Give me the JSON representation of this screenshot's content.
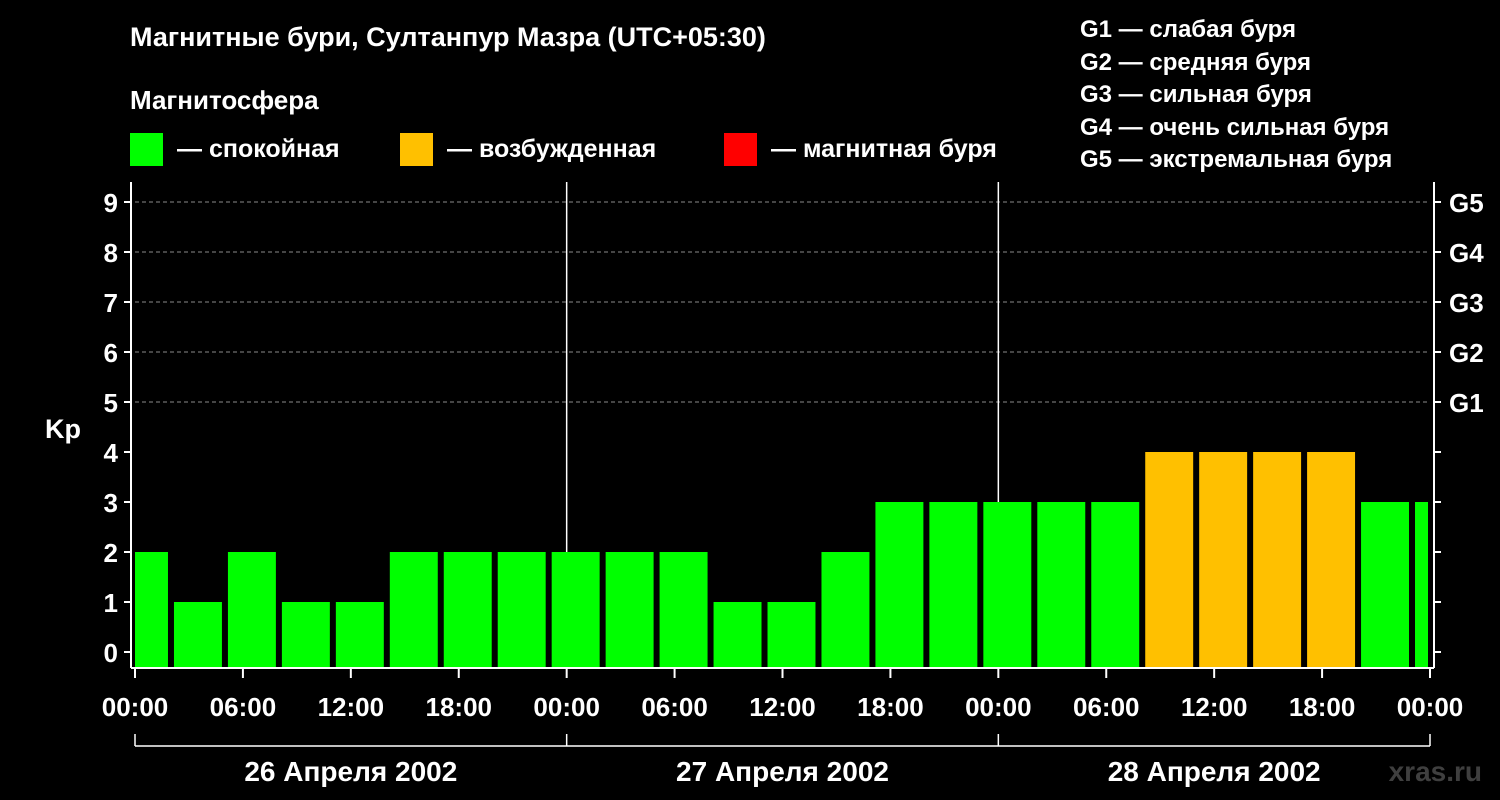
{
  "header": {
    "title": "Магнитные бури, Султанпур Мазра (UTC+05:30)",
    "subtitle": "Магнитосфера"
  },
  "legend": {
    "items": [
      {
        "color": "#00ff00",
        "label": "— спокойная"
      },
      {
        "color": "#ffc000",
        "label": "— возбужденная"
      },
      {
        "color": "#ff0000",
        "label": "— магнитная буря"
      }
    ]
  },
  "g_legend": [
    "G1 — слабая буря",
    "G2 — средняя буря",
    "G3 — сильная буря",
    "G4 — очень сильная буря",
    "G5 — экстремальная буря"
  ],
  "watermark": "xras.ru",
  "chart_data": {
    "type": "bar",
    "ylabel": "Kp",
    "ylim": [
      0,
      9
    ],
    "yticks": [
      0,
      1,
      2,
      3,
      4,
      5,
      6,
      7,
      8,
      9
    ],
    "right_ticks": [
      {
        "y": 5,
        "label": "G1"
      },
      {
        "y": 6,
        "label": "G2"
      },
      {
        "y": 7,
        "label": "G3"
      },
      {
        "y": 8,
        "label": "G4"
      },
      {
        "y": 9,
        "label": "G5"
      }
    ],
    "grid": "horizontal dashed at 5-9",
    "x_range_hours": [
      0,
      72
    ],
    "xtick_labels": [
      "00:00",
      "06:00",
      "12:00",
      "18:00",
      "00:00",
      "06:00",
      "12:00",
      "18:00",
      "00:00",
      "06:00",
      "12:00",
      "18:00",
      "00:00"
    ],
    "days": [
      "26 Апреля 2002",
      "27 Апреля 2002",
      "28 Апреля 2002"
    ],
    "colors": {
      "quiet": "#00ff00",
      "active": "#ffc000",
      "storm": "#ff0000"
    },
    "bars": [
      {
        "start": "2002-04-26 00:00",
        "end": "2002-04-26 02:00",
        "kp": 2,
        "level": "quiet"
      },
      {
        "start": "2002-04-26 02:00",
        "end": "2002-04-26 05:00",
        "kp": 1,
        "level": "quiet"
      },
      {
        "start": "2002-04-26 05:00",
        "end": "2002-04-26 08:00",
        "kp": 2,
        "level": "quiet"
      },
      {
        "start": "2002-04-26 08:00",
        "end": "2002-04-26 11:00",
        "kp": 1,
        "level": "quiet"
      },
      {
        "start": "2002-04-26 11:00",
        "end": "2002-04-26 14:00",
        "kp": 1,
        "level": "quiet"
      },
      {
        "start": "2002-04-26 14:00",
        "end": "2002-04-26 17:00",
        "kp": 2,
        "level": "quiet"
      },
      {
        "start": "2002-04-26 17:00",
        "end": "2002-04-26 20:00",
        "kp": 2,
        "level": "quiet"
      },
      {
        "start": "2002-04-26 20:00",
        "end": "2002-04-26 23:00",
        "kp": 2,
        "level": "quiet"
      },
      {
        "start": "2002-04-26 23:00",
        "end": "2002-04-27 02:00",
        "kp": 2,
        "level": "quiet"
      },
      {
        "start": "2002-04-27 02:00",
        "end": "2002-04-27 05:00",
        "kp": 2,
        "level": "quiet"
      },
      {
        "start": "2002-04-27 05:00",
        "end": "2002-04-27 08:00",
        "kp": 2,
        "level": "quiet"
      },
      {
        "start": "2002-04-27 08:00",
        "end": "2002-04-27 11:00",
        "kp": 1,
        "level": "quiet"
      },
      {
        "start": "2002-04-27 11:00",
        "end": "2002-04-27 14:00",
        "kp": 1,
        "level": "quiet"
      },
      {
        "start": "2002-04-27 14:00",
        "end": "2002-04-27 17:00",
        "kp": 2,
        "level": "quiet"
      },
      {
        "start": "2002-04-27 17:00",
        "end": "2002-04-27 20:00",
        "kp": 3,
        "level": "quiet"
      },
      {
        "start": "2002-04-27 20:00",
        "end": "2002-04-27 23:00",
        "kp": 3,
        "level": "quiet"
      },
      {
        "start": "2002-04-27 23:00",
        "end": "2002-04-28 02:00",
        "kp": 3,
        "level": "quiet"
      },
      {
        "start": "2002-04-28 02:00",
        "end": "2002-04-28 05:00",
        "kp": 3,
        "level": "quiet"
      },
      {
        "start": "2002-04-28 05:00",
        "end": "2002-04-28 08:00",
        "kp": 3,
        "level": "quiet"
      },
      {
        "start": "2002-04-28 08:00",
        "end": "2002-04-28 11:00",
        "kp": 4,
        "level": "active"
      },
      {
        "start": "2002-04-28 11:00",
        "end": "2002-04-28 14:00",
        "kp": 4,
        "level": "active"
      },
      {
        "start": "2002-04-28 14:00",
        "end": "2002-04-28 17:00",
        "kp": 4,
        "level": "active"
      },
      {
        "start": "2002-04-28 17:00",
        "end": "2002-04-28 20:00",
        "kp": 4,
        "level": "active"
      },
      {
        "start": "2002-04-28 20:00",
        "end": "2002-04-28 23:00",
        "kp": 3,
        "level": "quiet"
      },
      {
        "start": "2002-04-28 23:00",
        "end": "2002-04-29 00:00",
        "kp": 3,
        "level": "quiet"
      }
    ]
  }
}
